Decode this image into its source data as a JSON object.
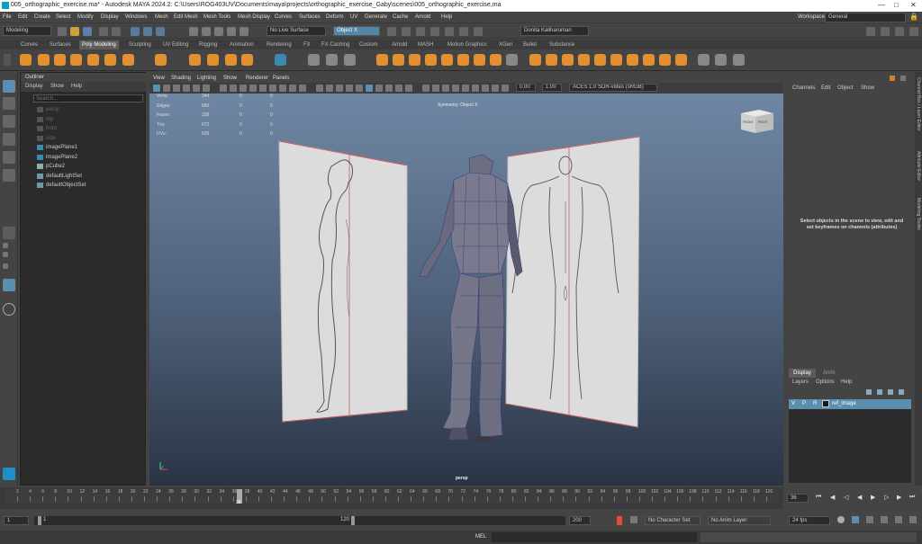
{
  "window": {
    "title": "005_orthographic_exercise.ma* - Autodesk MAYA 2024.2: C:\\Users\\ROG403UV\\Documents\\maya\\projects\\orthographic_exercise_Gaby\\scenes\\005_orthographic_exercise.ma"
  },
  "menubar": {
    "items": [
      "File",
      "Edit",
      "Create",
      "Select",
      "Modify",
      "Display",
      "Windows",
      "Mesh",
      "Edit Mesh",
      "Mesh Tools",
      "Mesh Display",
      "Curves",
      "Surfaces",
      "Deform",
      "UV",
      "Generate",
      "Cache",
      "Arnold",
      "Help"
    ],
    "workspace_label": "Workspace :",
    "workspace_value": "General"
  },
  "statusline": {
    "mode": "Modeling",
    "live_surface": "No Live Surface",
    "symmetry": "Object X",
    "user": "Donita Kaliharuman"
  },
  "shelf": {
    "tabs": [
      "Curves",
      "Surfaces",
      "Poly Modeling",
      "Sculpting",
      "UV Editing",
      "Rigging",
      "Animation",
      "Rendering",
      "FX",
      "FX Caching",
      "Custom",
      "Arnold",
      "MASH",
      "Motion Graphics",
      "XGen",
      "Bullet",
      "Substance"
    ],
    "active_tab": "Poly Modeling"
  },
  "outliner": {
    "title": "Outliner",
    "menu": [
      "Display",
      "Show",
      "Help"
    ],
    "search_placeholder": "Search...",
    "items": [
      {
        "label": "persp",
        "dim": true
      },
      {
        "label": "top",
        "dim": true
      },
      {
        "label": "front",
        "dim": true
      },
      {
        "label": "side",
        "dim": true
      },
      {
        "label": "imagePlane1",
        "dim": false
      },
      {
        "label": "imagePlane2",
        "dim": false
      },
      {
        "label": "pCube2",
        "dim": false
      },
      {
        "label": "defaultLightSet",
        "dim": false
      },
      {
        "label": "defaultObjectSet",
        "dim": false
      }
    ]
  },
  "viewport": {
    "menu": [
      "View",
      "Shading",
      "Lighting",
      "Show",
      "Renderer",
      "Panels"
    ],
    "exposure": "0.00",
    "gamma": "1.00",
    "colorspace": "ACES 1.0 SDR-video (sRGB)",
    "symmetry_label": "Symmetry: Object X",
    "camera_label": "persp",
    "viewcube_front": "FRONT",
    "viewcube_right": "RIGHT",
    "hud": [
      {
        "label": "Verts:",
        "values": [
          "344",
          "0",
          "0"
        ]
      },
      {
        "label": "Edges:",
        "values": [
          "680",
          "0",
          "0"
        ]
      },
      {
        "label": "Faces:",
        "values": [
          "338",
          "0",
          "0"
        ]
      },
      {
        "label": "Tris:",
        "values": [
          "672",
          "0",
          "0"
        ]
      },
      {
        "label": "UVs:",
        "values": [
          "626",
          "0",
          "0"
        ]
      }
    ]
  },
  "channelbox": {
    "menu": [
      "Channels",
      "Edit",
      "Object",
      "Show"
    ],
    "message": "Select objects in the scene to view, edit and set keyframes on channels (attributes)"
  },
  "layers": {
    "tabs": [
      "Display",
      "Anim"
    ],
    "menu": [
      "Layers",
      "Options",
      "Help"
    ],
    "layer": {
      "v": "V",
      "p": "P",
      "r": "R",
      "name": "ref_image"
    }
  },
  "right_strip": {
    "labels": [
      "Channel Box / Layer Editor",
      "Attribute Editor",
      "Modeling Toolkit"
    ]
  },
  "timeline": {
    "ticks": [
      "2",
      "4",
      "6",
      "8",
      "10",
      "12",
      "14",
      "16",
      "18",
      "20",
      "22",
      "24",
      "26",
      "28",
      "30",
      "32",
      "34",
      "36",
      "38",
      "40",
      "42",
      "44",
      "46",
      "48",
      "50",
      "52",
      "54",
      "56",
      "58",
      "60",
      "62",
      "64",
      "66",
      "68",
      "70",
      "72",
      "74",
      "76",
      "78",
      "80",
      "82",
      "84",
      "86",
      "88",
      "90",
      "92",
      "94",
      "96",
      "98",
      "100",
      "102",
      "104",
      "106",
      "108",
      "110",
      "112",
      "114",
      "116",
      "118",
      "120"
    ],
    "current_frame": "36",
    "current_frame_field": "36"
  },
  "range": {
    "start": "1",
    "inner_start": "1",
    "inner_end": "120",
    "end_field": "200",
    "character_set": "No Character Set",
    "anim_layer": "No Anim Layer",
    "fps": "24 fps"
  },
  "cmdline": {
    "label": "MEL"
  },
  "colors": {
    "accent": "#5285a6",
    "shelf_orange": "#e09030",
    "layer_selected": "#5b8fb0"
  }
}
